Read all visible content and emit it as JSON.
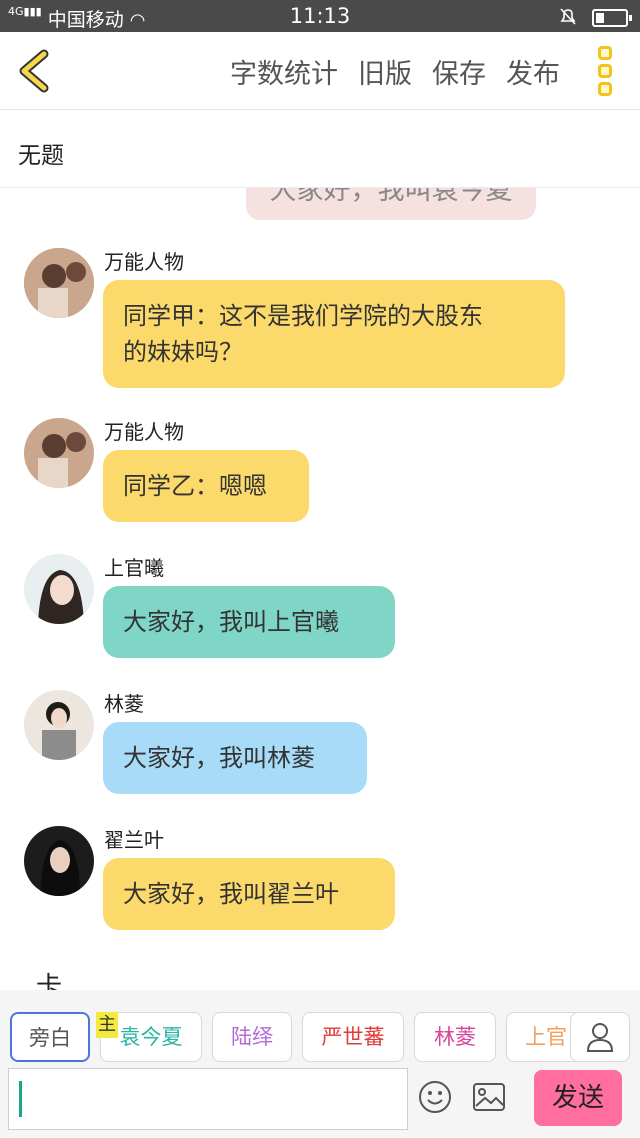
{
  "status_bar": {
    "carrier": "中国移动",
    "time": "11:13"
  },
  "toolbar": {
    "word_count": "字数统计",
    "old_version": "旧版",
    "save": "保存",
    "publish": "发布"
  },
  "story": {
    "title": "无题"
  },
  "chat": {
    "partial_text": "大家好，我叫袁今夏",
    "messages": [
      {
        "name": "万能人物",
        "text_lines": [
          "同学甲：这不是我们学院的大股东",
          "的妹妹吗？"
        ],
        "color": "#fcd96b"
      },
      {
        "name": "万能人物",
        "text_lines": [
          "同学乙：嗯嗯"
        ],
        "color": "#fcd96b"
      },
      {
        "name": "上官曦",
        "text_lines": [
          "大家好，我叫上官曦"
        ],
        "color": "#7fd6c6"
      },
      {
        "name": "林菱",
        "text_lines": [
          "大家好，我叫林菱"
        ],
        "color": "#a8dbf7"
      },
      {
        "name": "翟兰叶",
        "text_lines": [
          "大家好，我叫翟兰叶"
        ],
        "color": "#fcd96b"
      }
    ],
    "cut_text": "卡"
  },
  "roles": {
    "master_badge": "主",
    "chips": [
      {
        "label": "旁白",
        "color": "#555555"
      },
      {
        "label": "袁今夏",
        "color": "#2bb3a3"
      },
      {
        "label": "陆绎",
        "color": "#b46ad6"
      },
      {
        "label": "严世蕃",
        "color": "#e23b3b"
      },
      {
        "label": "林菱",
        "color": "#d6459a"
      },
      {
        "label": "上官",
        "color": "#f0a060"
      }
    ]
  },
  "input": {
    "value": "",
    "send_label": "发送"
  }
}
